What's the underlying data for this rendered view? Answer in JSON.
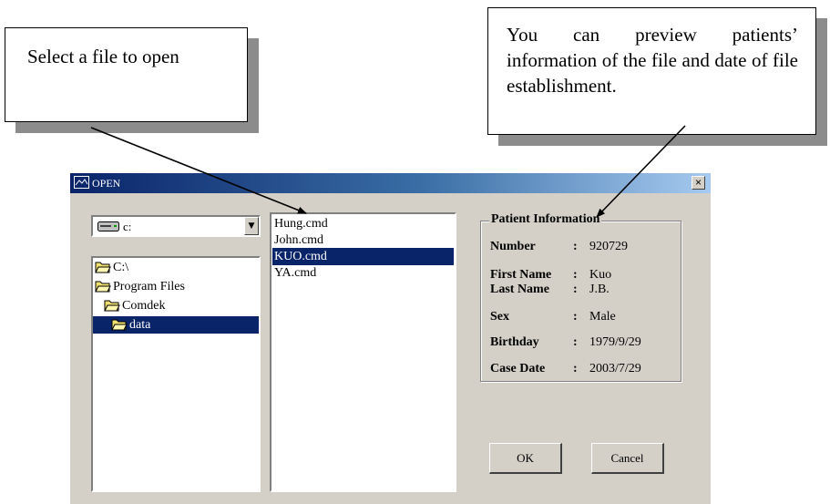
{
  "callouts": {
    "left_text": "Select a file to open",
    "right_text": "You can preview patients’ information of the file and date of file establishment."
  },
  "dialog": {
    "title": "OPEN",
    "close_glyph": "×",
    "drive": {
      "value": "c:",
      "dropdown_glyph": "▼"
    },
    "folders": [
      {
        "label": "C:\\",
        "selected": false
      },
      {
        "label": "Program Files",
        "selected": false
      },
      {
        "label": "Comdek",
        "selected": false
      },
      {
        "label": "data",
        "selected": true
      }
    ],
    "files": [
      {
        "label": "Hung.cmd",
        "selected": false
      },
      {
        "label": "John.cmd",
        "selected": false
      },
      {
        "label": "KUO.cmd",
        "selected": true
      },
      {
        "label": "YA.cmd",
        "selected": false
      }
    ],
    "patient_info": {
      "title": "Patient Information",
      "colon": ":",
      "number_label": "Number",
      "number_value": "920729",
      "first_name_label": "First Name",
      "first_name_value": "Kuo",
      "last_name_label": "Last Name",
      "last_name_value": "J.B.",
      "sex_label": "Sex",
      "sex_value": "Male",
      "birthday_label": "Birthday",
      "birthday_value": "1979/9/29",
      "case_date_label": "Case Date",
      "case_date_value": "2003/7/29"
    },
    "ok_label": "OK",
    "cancel_label": "Cancel"
  },
  "colors": {
    "dialog_face": "#d4d0c8",
    "title_bar": "#0a246a",
    "selection": "#0a246a",
    "callout_shadow": "#8c8c8c"
  }
}
